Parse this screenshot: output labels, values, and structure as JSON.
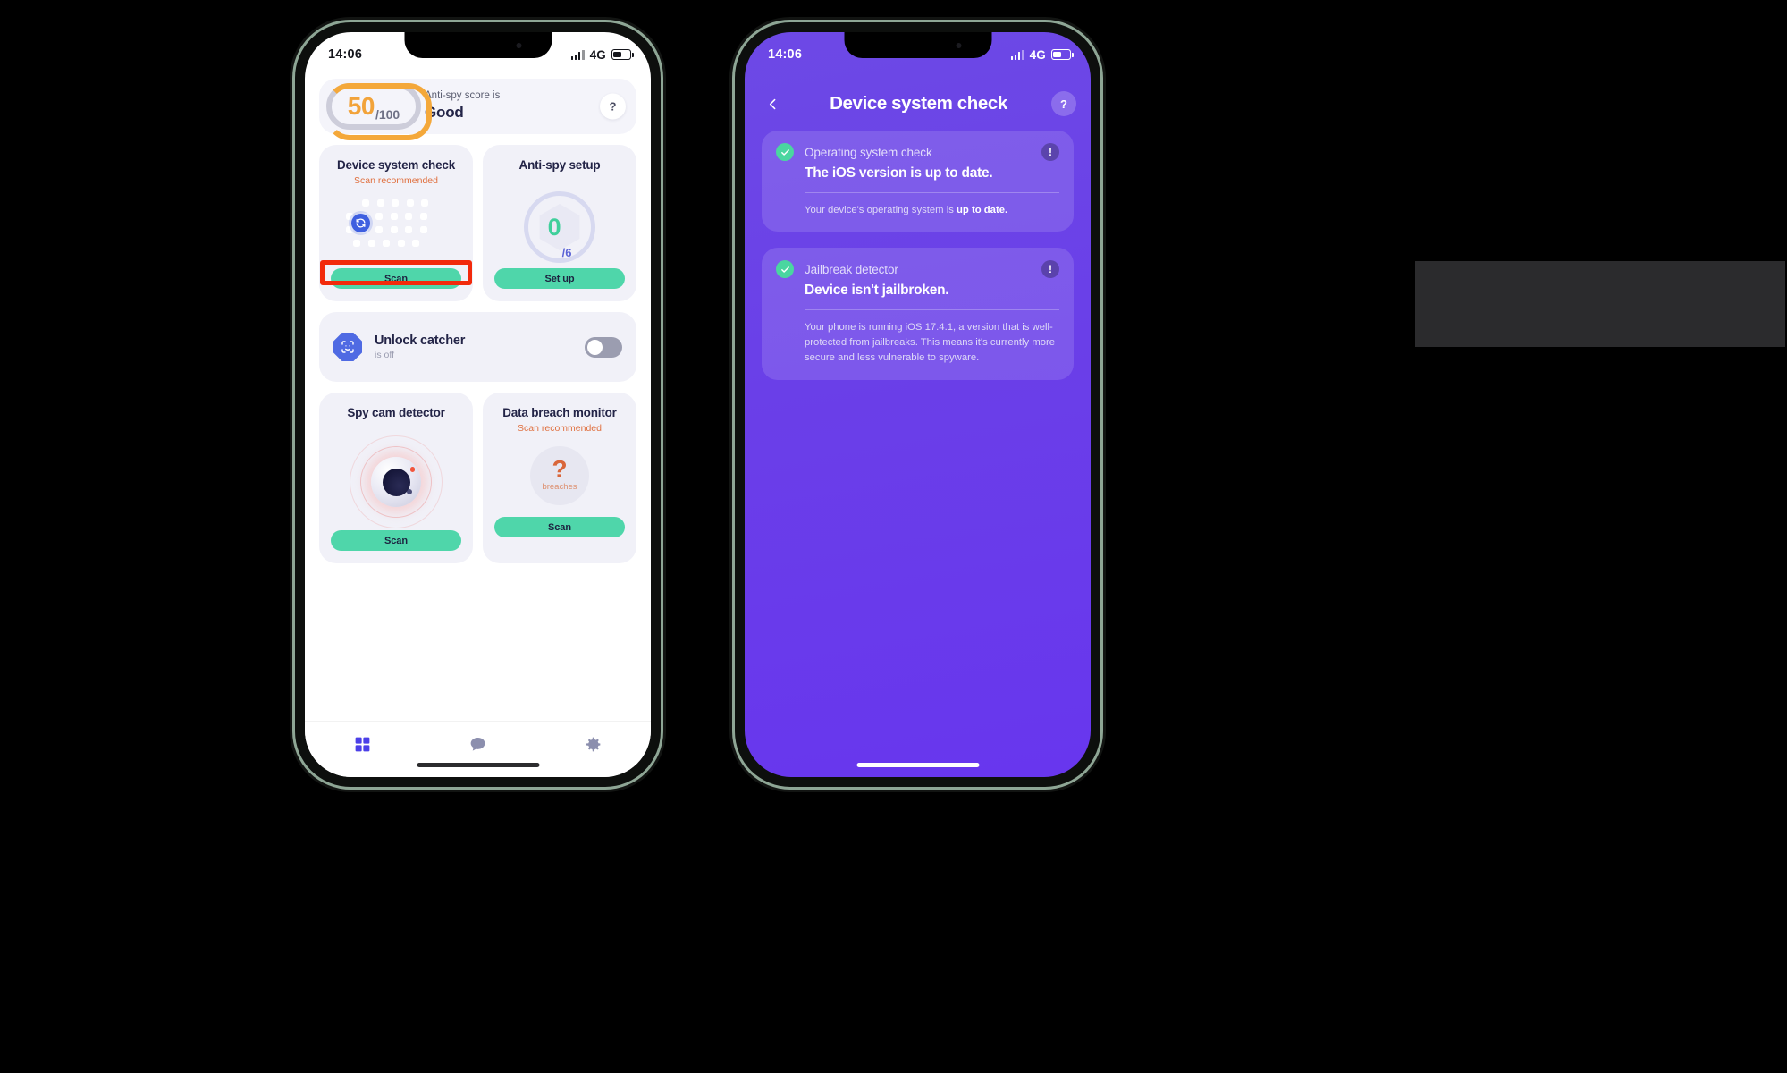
{
  "left_phone": {
    "status_bar": {
      "time": "14:06",
      "network": "4G",
      "signal_icon": "signal-bars-icon",
      "battery_icon": "battery-icon"
    },
    "score_card": {
      "score": "50",
      "denominator": "/100",
      "caption": "Anti-spy score is",
      "rating": "Good",
      "help_label": "?"
    },
    "cards": [
      {
        "title": "Device system check",
        "subtitle": "Scan recommended",
        "illustration": "dot-matrix-refresh-icon",
        "button": "Scan",
        "highlighted": true
      },
      {
        "title": "Anti-spy setup",
        "subtitle": "",
        "illustration": "progress-ring-hexagon",
        "progress_value": "0",
        "progress_total": "/6",
        "button": "Set up",
        "highlighted": false
      },
      {
        "title": "Spy cam detector",
        "subtitle": "",
        "illustration": "camera-lens-icon",
        "button": "Scan",
        "highlighted": false
      },
      {
        "title": "Data breach monitor",
        "subtitle": "Scan recommended",
        "illustration": "question-mark-circle",
        "breach_value": "?",
        "breach_label": "breaches",
        "button": "Scan",
        "highlighted": false
      }
    ],
    "unlock_catcher": {
      "icon": "face-id-octagon-icon",
      "title": "Unlock catcher",
      "subtitle": "is off",
      "toggle_state": "off"
    },
    "tabbar": [
      {
        "name": "dashboard",
        "icon": "grid-icon",
        "active": true
      },
      {
        "name": "chat",
        "icon": "chat-bubble-icon",
        "active": false
      },
      {
        "name": "settings",
        "icon": "gear-icon",
        "active": false
      }
    ]
  },
  "right_phone": {
    "status_bar": {
      "time": "14:06",
      "network": "4G",
      "signal_icon": "signal-bars-icon",
      "battery_icon": "battery-icon"
    },
    "header": {
      "back_icon": "chevron-left-icon",
      "title": "Device system check",
      "help_label": "?"
    },
    "results": [
      {
        "check_icon": "check-circle-icon",
        "name": "Operating system check",
        "status": "The iOS version is up to date.",
        "description_prefix": "Your device's operating system is ",
        "description_bold": "up to date.",
        "info_icon": "exclamation-circle-icon"
      },
      {
        "check_icon": "check-circle-icon",
        "name": "Jailbreak detector",
        "status": "Device isn't jailbroken.",
        "description_prefix": "Your phone is running iOS 17.4.1, a version that is well-protected from jailbreaks. This means it's currently more secure and less vulnerable to spyware.",
        "description_bold": "",
        "info_icon": "exclamation-circle-icon"
      }
    ]
  },
  "colors": {
    "accent_green": "#4fd6aa",
    "accent_orange": "#f2a33a",
    "warning_orange": "#e0703f",
    "purple_bg": "#6a3fe8",
    "highlight_red": "#f22a0c",
    "navy_text": "#232447"
  }
}
